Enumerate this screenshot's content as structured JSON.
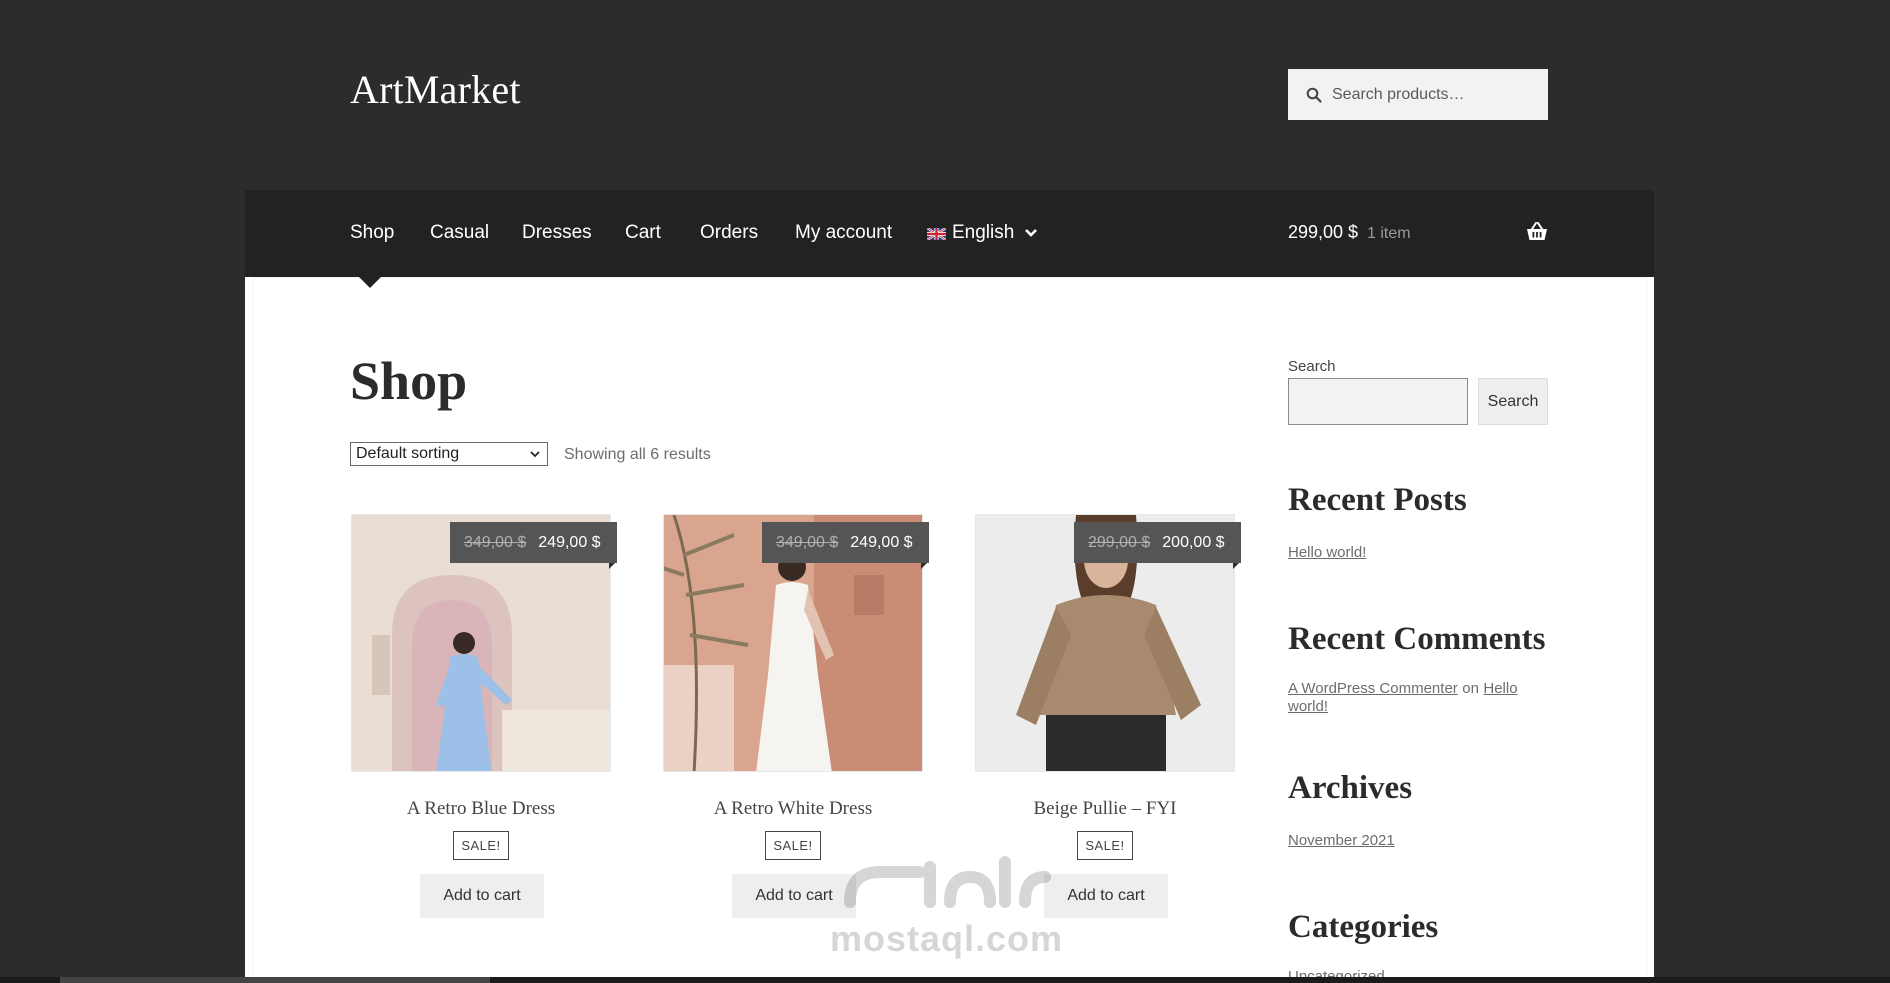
{
  "header": {
    "site_title": "ArtMarket",
    "search_placeholder": "Search products…"
  },
  "nav": {
    "items": [
      {
        "label": "Shop",
        "active": true
      },
      {
        "label": "Casual"
      },
      {
        "label": "Dresses"
      },
      {
        "label": "Cart"
      },
      {
        "label": "Orders"
      },
      {
        "label": "My account"
      }
    ],
    "language": {
      "label": "English",
      "flag": "uk-flag-icon"
    },
    "cart": {
      "total": "299,00 $",
      "count": "1 item",
      "icon": "basket-icon"
    }
  },
  "main": {
    "title": "Shop",
    "sort": {
      "selected": "Default sorting"
    },
    "result_count": "Showing all 6 results",
    "products": [
      {
        "name": "A Retro Blue Dress",
        "old_price": "349,00 $",
        "price": "249,00 $",
        "badge": "SALE!",
        "button": "Add to cart"
      },
      {
        "name": "A Retro White Dress",
        "old_price": "349,00 $",
        "price": "249,00 $",
        "badge": "SALE!",
        "button": "Add to cart"
      },
      {
        "name": "Beige Pullie – FYI",
        "old_price": "299,00 $",
        "price": "200,00 $",
        "badge": "SALE!",
        "button": "Add to cart"
      }
    ]
  },
  "sidebar": {
    "search": {
      "label": "Search",
      "button": "Search"
    },
    "recent_posts": {
      "heading": "Recent Posts",
      "links": [
        "Hello world!"
      ]
    },
    "recent_comments": {
      "heading": "Recent Comments",
      "author": "A WordPress Commenter",
      "joiner": "on",
      "post_line1": "Hello",
      "post_line2": "world!"
    },
    "archives": {
      "heading": "Archives",
      "links": [
        "November 2021"
      ]
    },
    "categories": {
      "heading": "Categories",
      "links": [
        "Uncategorized"
      ]
    }
  },
  "watermark": {
    "text": "mostaql.com"
  },
  "colors": {
    "page_bg": "#2c2c2c",
    "nav_bg": "#222222",
    "panel_bg": "#ffffff",
    "price_tag_bg": "#555555",
    "button_bg": "#eeeeee"
  }
}
